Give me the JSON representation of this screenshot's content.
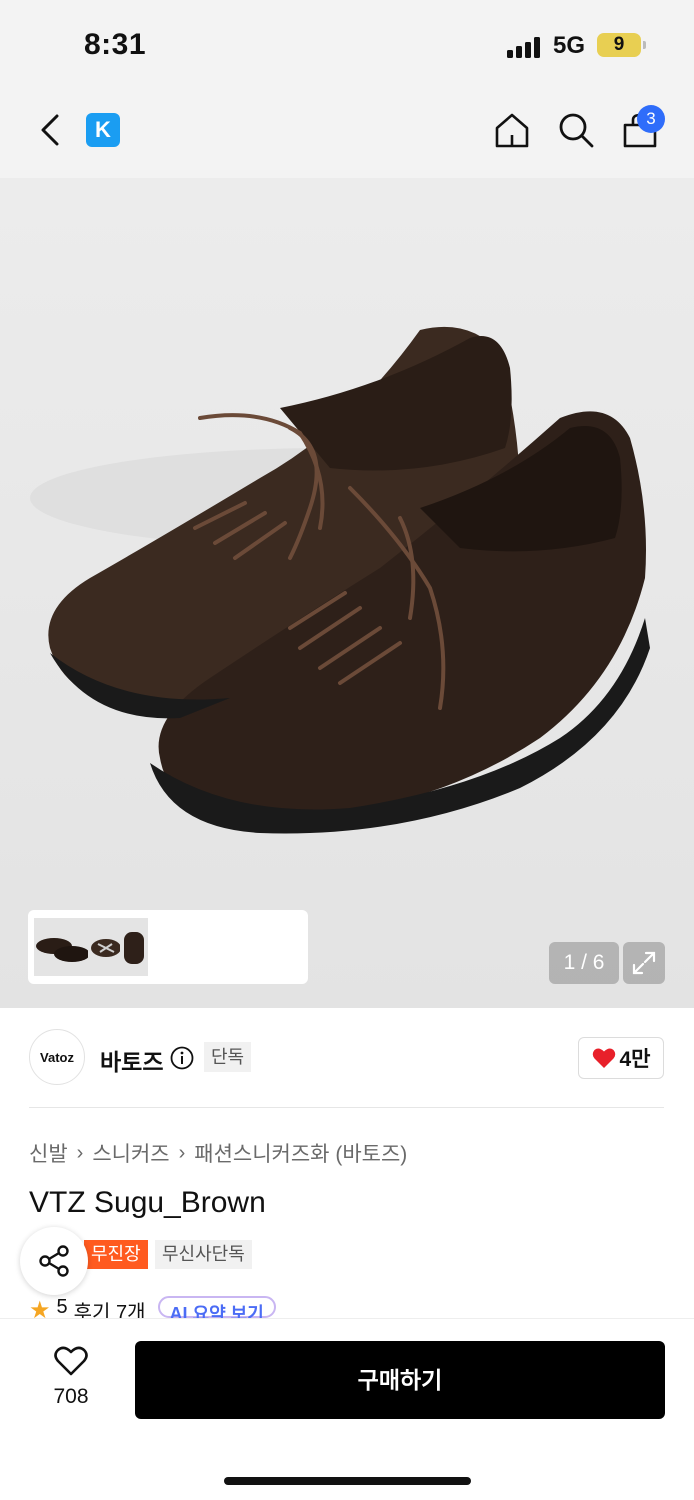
{
  "status_bar": {
    "time": "8:31",
    "network": "5G",
    "battery": "9"
  },
  "nav": {
    "logo_letter": "K",
    "cart_count": "3"
  },
  "gallery": {
    "page_indicator": "1 / 6"
  },
  "brand": {
    "logo_text": "Vatoz",
    "name": "바토즈",
    "exclusive_tag": "단독",
    "like_count": "4만"
  },
  "breadcrumb": [
    "신발",
    "스니커즈",
    "패션스니커즈화 (바토즈)"
  ],
  "product": {
    "title": "VTZ Sugu_Brown",
    "tags": [
      "무진장",
      "무신사단독"
    ],
    "rating": "5",
    "review_text": "후기 7개",
    "ai_summary": "AI 요약 보기"
  },
  "bottom": {
    "wish_count": "708",
    "buy_label": "구매하기"
  },
  "colors": {
    "accent_blue": "#1a9df2",
    "badge_blue": "#2f6dfa",
    "tag_orange": "#ff5a1f",
    "heart_red": "#e8202a"
  }
}
